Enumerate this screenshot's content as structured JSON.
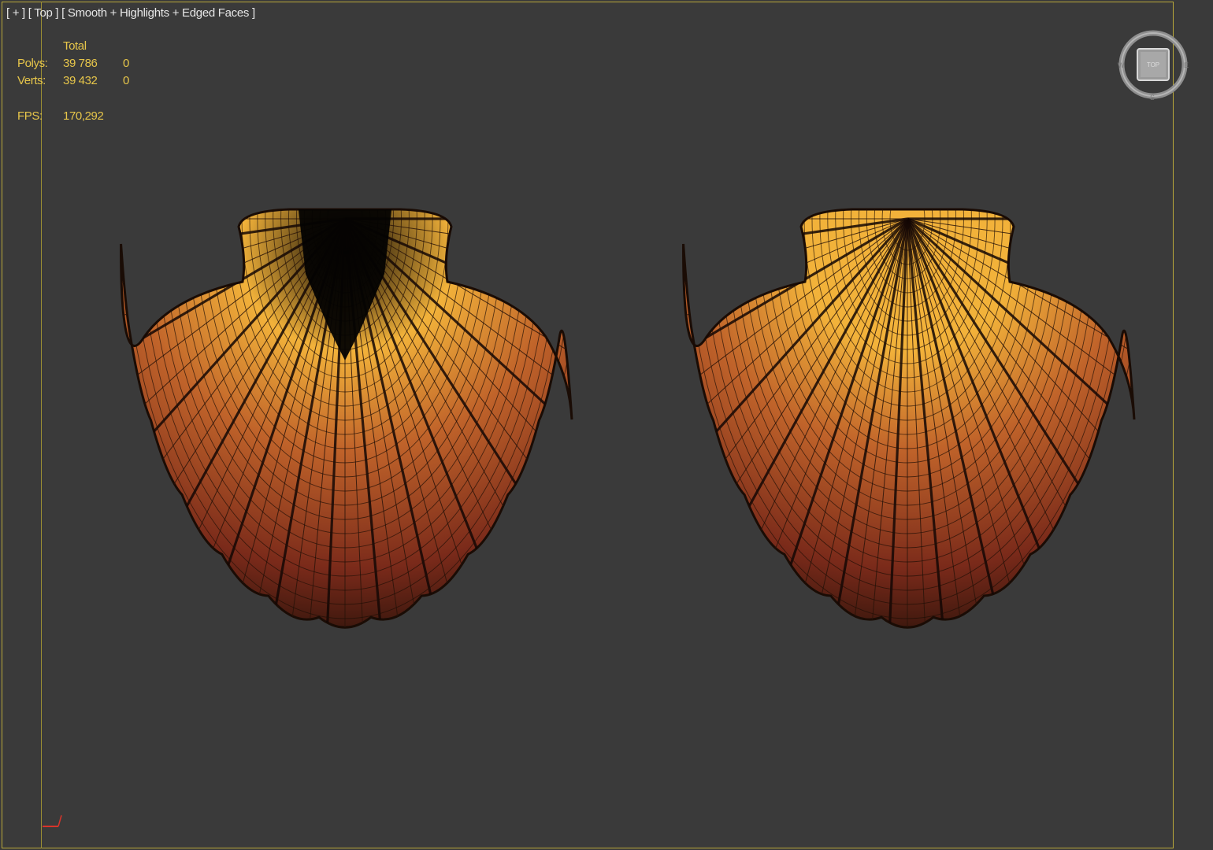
{
  "viewport": {
    "label": "[ + ] [ Top ] [ Smooth + Highlights + Edged Faces ]",
    "border_color": "#b9a83a",
    "background": "#3a3a3a"
  },
  "stats": {
    "header": "Total",
    "polys_label": "Polys:",
    "polys_total": "39 786",
    "polys_selected": "0",
    "verts_label": "Verts:",
    "verts_total": "39 432",
    "verts_selected": "0",
    "fps_label": "FPS:",
    "fps_value": "170,292",
    "text_color": "#e7c64a"
  },
  "viewcube": {
    "face_label": "TOP"
  },
  "scene": {
    "objects": [
      {
        "name": "scallop-shell-left",
        "view": "outer"
      },
      {
        "name": "scallop-shell-right",
        "view": "outer"
      }
    ],
    "shell_colors": [
      "#f2b23a",
      "#c0632a",
      "#7a2a1a",
      "#2a120a"
    ]
  }
}
